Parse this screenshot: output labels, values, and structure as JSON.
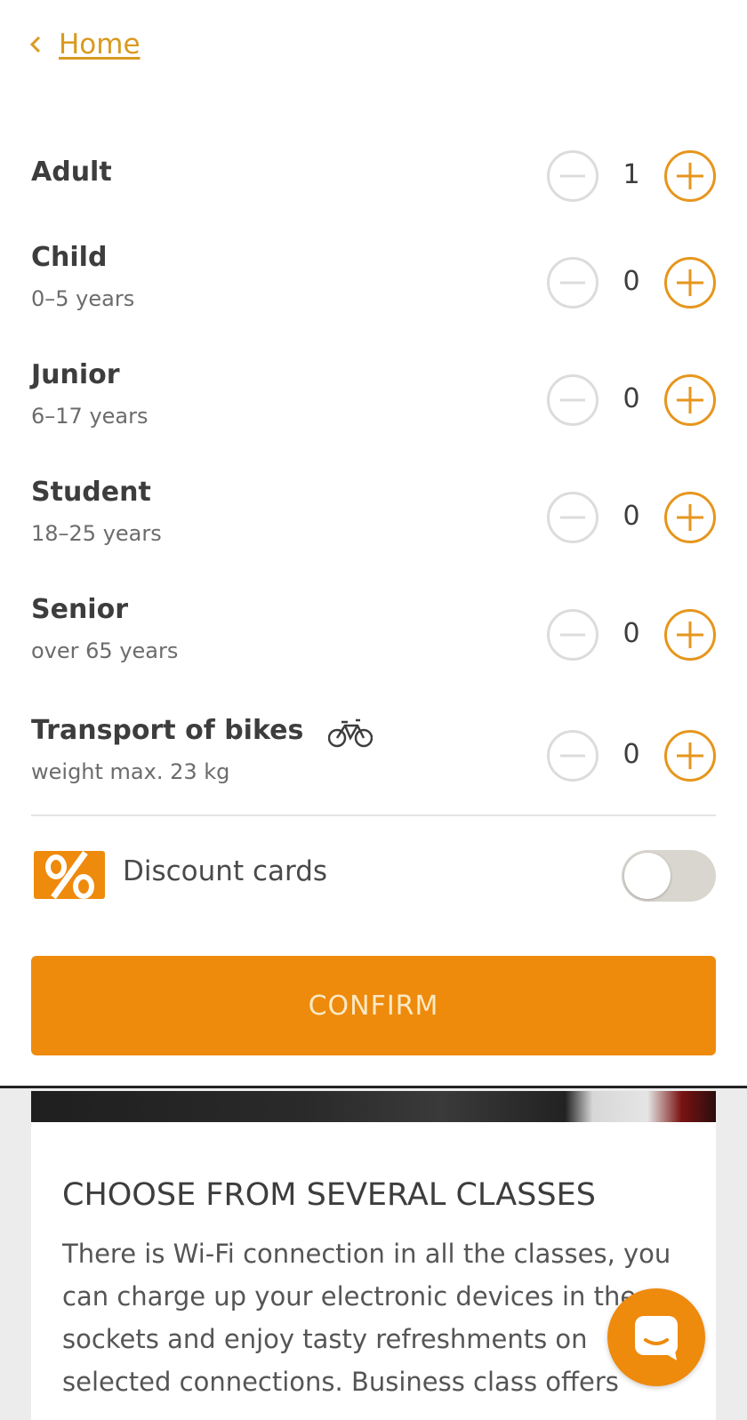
{
  "nav": {
    "back_label": "Home"
  },
  "passengers": [
    {
      "title": "Adult",
      "subtitle": "",
      "count": "1"
    },
    {
      "title": "Child",
      "subtitle": "0–5 years",
      "count": "0"
    },
    {
      "title": "Junior",
      "subtitle": "6–17 years",
      "count": "0"
    },
    {
      "title": "Student",
      "subtitle": "18–25 years",
      "count": "0"
    },
    {
      "title": "Senior",
      "subtitle": "over 65 years",
      "count": "0"
    },
    {
      "title": "Transport of bikes",
      "subtitle": "weight max. 23 kg",
      "count": "0",
      "icon": "bicycle-icon"
    }
  ],
  "discount": {
    "label": "Discount cards",
    "icon": "percent-icon",
    "enabled": false
  },
  "confirm_label": "CONFIRM",
  "promo": {
    "heading": "CHOOSE FROM SEVERAL CLASSES",
    "body": "There is Wi-Fi connection in all the classes, you can charge up your electronic devices in the sockets and enjoy tasty refreshments on selected connections. Business class offers"
  },
  "colors": {
    "accent": "#ee8a0c",
    "link": "#d99a21",
    "disabled": "#dcdcdc"
  },
  "chat": {
    "icon": "chat-icon"
  }
}
